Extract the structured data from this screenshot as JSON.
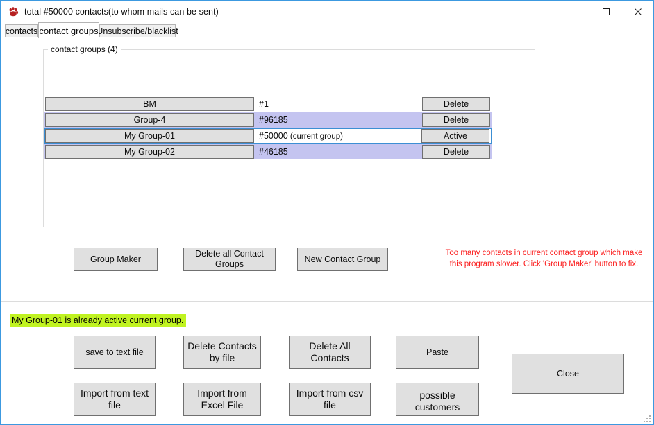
{
  "window": {
    "title": "total #50000 contacts(to whom mails can be sent)",
    "icon": "paw-icon",
    "minimize_label": "–",
    "maximize_label": "☐",
    "close_label": "✕"
  },
  "tabs": [
    {
      "label": "contacts",
      "selected": false
    },
    {
      "label": "contact groups",
      "selected": true
    },
    {
      "label": "Unsubscribe/blacklist",
      "selected": false
    }
  ],
  "groupbox": {
    "legend": "contact groups (4)"
  },
  "groups": [
    {
      "name": "BM",
      "count": "#1",
      "count_note": "",
      "action": "Delete",
      "highlighted": false,
      "selected": false
    },
    {
      "name": "Group-4",
      "count": "#96185",
      "count_note": "",
      "action": "Delete",
      "highlighted": true,
      "selected": false
    },
    {
      "name": "My Group-01",
      "count": "#50000",
      "count_note": " (current group)",
      "action": "Active",
      "highlighted": false,
      "selected": true
    },
    {
      "name": "My Group-02",
      "count": "#46185",
      "count_note": "",
      "action": "Delete",
      "highlighted": true,
      "selected": false
    }
  ],
  "actions": {
    "group_maker": "Group Maker",
    "delete_all_groups": "Delete all Contact Groups",
    "new_contact_group": "New Contact Group"
  },
  "warning": {
    "text": "Too many contacts in current contact group which make this program slower. Click 'Group Maker' button to fix.",
    "color": "#fb2020"
  },
  "status": {
    "text": "My Group-01 is already active current group.",
    "highlight_color": "#c0f321"
  },
  "bottom_buttons": {
    "save_to_text_file": "save to text file",
    "delete_contacts_by_file": "Delete Contacts by file",
    "delete_all_contacts": "Delete All Contacts",
    "paste": "Paste",
    "close": "Close",
    "import_from_text_file": "Import from text file",
    "import_from_excel_file": "Import from Excel File",
    "import_from_csv_file": "Import from csv file",
    "possible_customers": "possible customers"
  }
}
